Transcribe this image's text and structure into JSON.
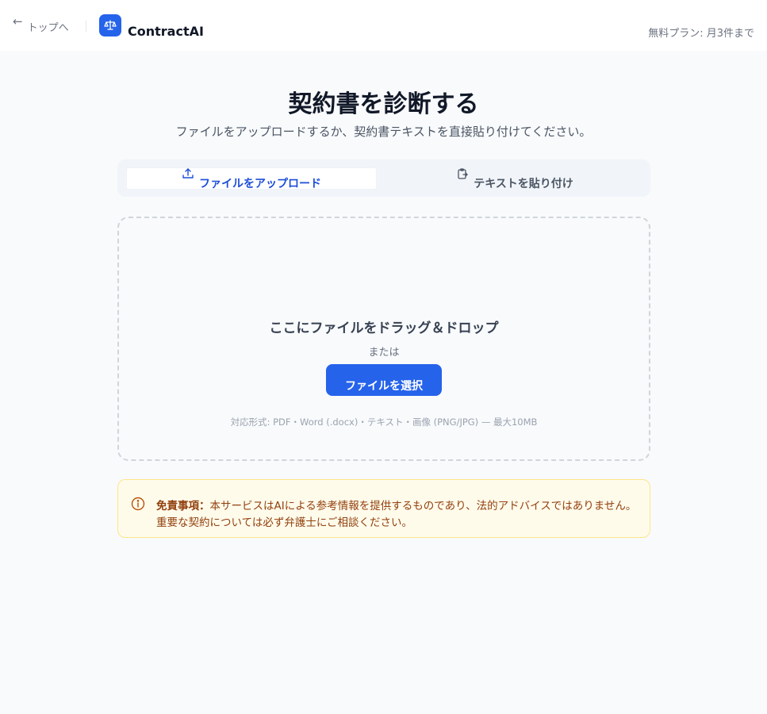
{
  "header": {
    "back_label": "トップへ",
    "brand": "ContractAI",
    "plan": "無料プラン: 月3件まで"
  },
  "main": {
    "title": "契約書を診断する",
    "subtitle": "ファイルをアップロードするか、契約書テキストを直接貼り付けてください。"
  },
  "tabs": [
    {
      "label": "ファイルをアップロード",
      "icon": "upload-icon",
      "active": true
    },
    {
      "label": "テキストを貼り付け",
      "icon": "clipboard-icon",
      "active": false
    }
  ],
  "dropzone": {
    "title": "ここにファイルをドラッグ＆ドロップ",
    "or": "または",
    "button": "ファイルを選択",
    "formats": "対応形式: PDF・Word (.docx)・テキスト・画像 (PNG/JPG) — 最大10MB"
  },
  "notice": {
    "label": "免責事項：",
    "text": "本サービスはAIによる参考情報を提供するものであり、法的アドバイスではありません。 重要な契約については必ず弁護士にご相談ください。"
  },
  "colors": {
    "accent": "#2563eb",
    "notice_bg": "#fffbeb",
    "notice_border": "#fde68a",
    "notice_text": "#92400e"
  }
}
